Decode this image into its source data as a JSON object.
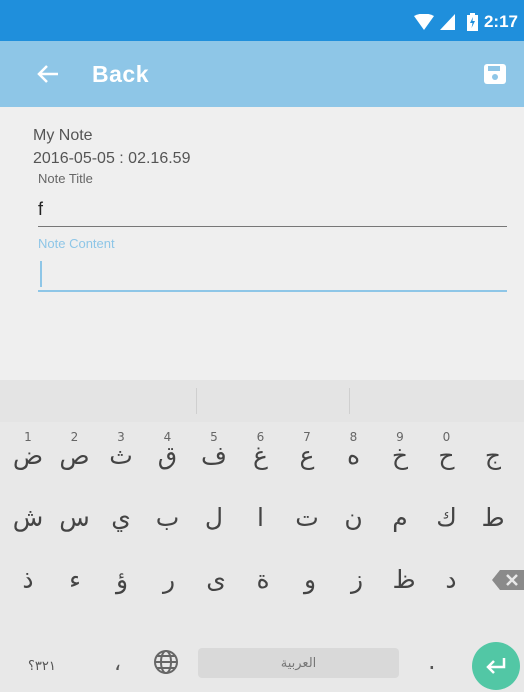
{
  "status_bar": {
    "time": "2:17"
  },
  "app_bar": {
    "back_label": "Back"
  },
  "note": {
    "name": "My Note",
    "date": "2016-05-05 : 02.16.59",
    "title_label": "Note Title",
    "title_value": "f",
    "content_label": "Note Content",
    "content_value": ""
  },
  "keyboard": {
    "row1": [
      {
        "char": "ض",
        "hint": "1"
      },
      {
        "char": "ص",
        "hint": "2"
      },
      {
        "char": "ث",
        "hint": "3"
      },
      {
        "char": "ق",
        "hint": "4"
      },
      {
        "char": "ف",
        "hint": "5"
      },
      {
        "char": "غ",
        "hint": "6"
      },
      {
        "char": "ع",
        "hint": "7"
      },
      {
        "char": "ه",
        "hint": "8"
      },
      {
        "char": "خ",
        "hint": "9"
      },
      {
        "char": "ح",
        "hint": "0"
      },
      {
        "char": "ج",
        "hint": ""
      }
    ],
    "row2": [
      "ش",
      "س",
      "ي",
      "ب",
      "ل",
      "ا",
      "ت",
      "ن",
      "م",
      "ك",
      "ط"
    ],
    "row3": [
      "ذ",
      "ء",
      "ؤ",
      "ر",
      "ى",
      "ة",
      "و",
      "ز",
      "ظ",
      "د"
    ],
    "numbers_key": "٣٢١؟",
    "comma_key": "،",
    "space_label": "العربية",
    "period_key": "."
  },
  "colors": {
    "status_bar": "#1f8fdc",
    "app_bar": "#8ec6e7",
    "accent": "#8ec6e7",
    "enter_key": "#52c7a5"
  },
  "icons": {
    "back": "arrow-left-icon",
    "save": "floppy-disk-icon",
    "globe": "globe-icon",
    "backspace": "backspace-icon",
    "enter": "enter-arrow-icon",
    "wifi": "wifi-icon",
    "signal": "signal-icon",
    "battery": "battery-charging-icon"
  }
}
